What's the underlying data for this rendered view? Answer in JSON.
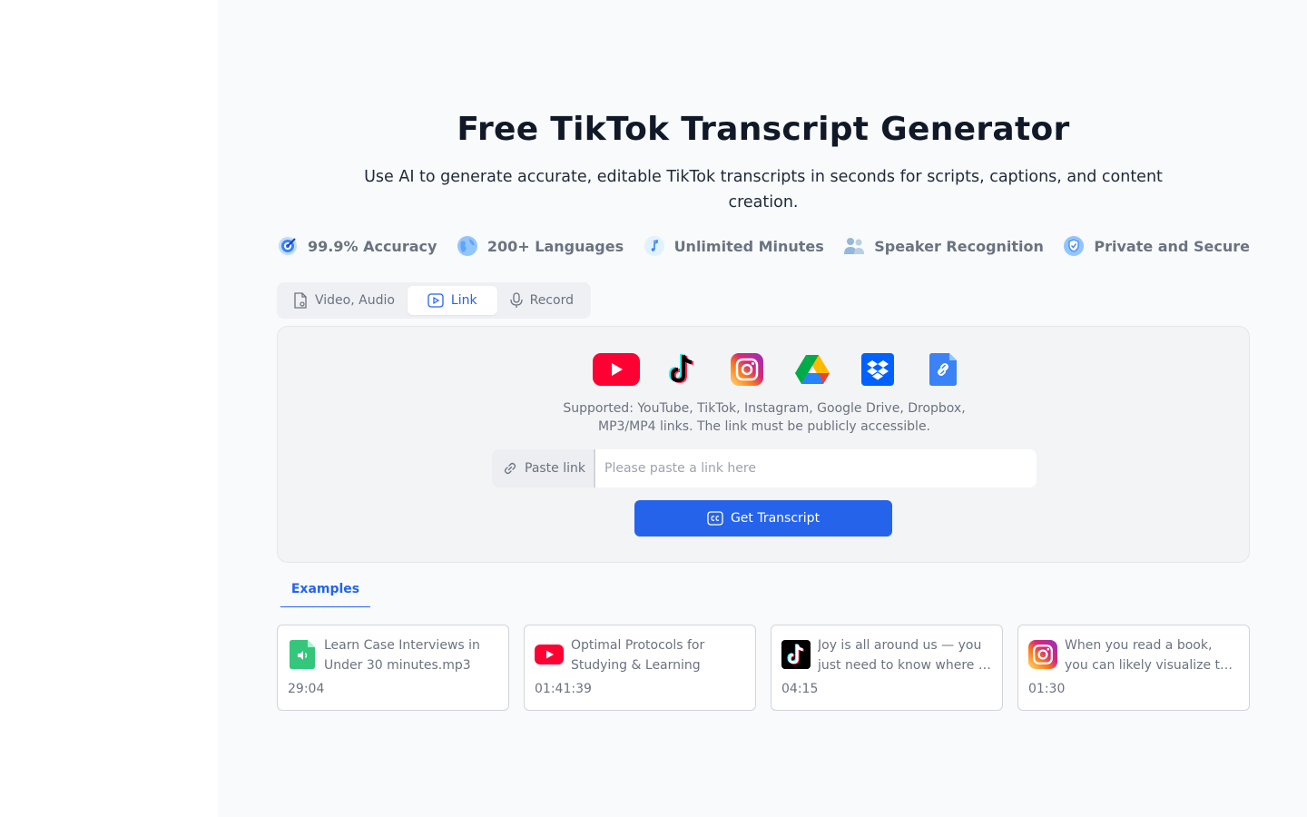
{
  "page": {
    "title": "Free TikTok Transcript Generator",
    "subtitle": "Use AI to generate accurate, editable TikTok transcripts in seconds for scripts, captions, and content creation."
  },
  "features": [
    {
      "label": "99.9% Accuracy",
      "icon": "target-icon"
    },
    {
      "label": "200+ Languages",
      "icon": "globe-icon"
    },
    {
      "label": "Unlimited Minutes",
      "icon": "music-note-icon"
    },
    {
      "label": "Speaker Recognition",
      "icon": "people-icon"
    },
    {
      "label": "Private and Secure",
      "icon": "shield-icon"
    }
  ],
  "tabs": [
    {
      "label": "Video, Audio",
      "active": false
    },
    {
      "label": "Link",
      "active": true
    },
    {
      "label": "Record",
      "active": false
    }
  ],
  "panel": {
    "sources": [
      "youtube-icon",
      "tiktok-icon",
      "instagram-icon",
      "google-drive-icon",
      "dropbox-icon",
      "link-file-icon"
    ],
    "supported_line1": "Supported: YouTube, TikTok, Instagram, Google Drive, Dropbox,",
    "supported_line2": "MP3/MP4 links. The link must be publicly accessible.",
    "paste_label": "Paste link",
    "input_placeholder": "Please paste a link here",
    "input_value": "",
    "button_label": "Get Transcript"
  },
  "examples": {
    "tab_label": "Examples",
    "cards": [
      {
        "title": "Learn Case Interviews in Under 30 minutes.mp3",
        "duration": "29:04",
        "icon": "audio-file-icon"
      },
      {
        "title": "Optimal Protocols for Studying & Learning",
        "duration": "01:41:39",
        "icon": "youtube-icon"
      },
      {
        "title": "Joy is all around us — you just need to know where to look",
        "duration": "04:15",
        "icon": "tiktok-icon"
      },
      {
        "title": "When you read a book, you can likely visualize the scenes",
        "duration": "01:30",
        "icon": "instagram-icon"
      }
    ]
  },
  "colors": {
    "accent": "#2563eb",
    "youtube": "#ff0033",
    "tiktok": "#000000",
    "dropbox": "#0061fe",
    "audio_file": "#34c77b"
  }
}
